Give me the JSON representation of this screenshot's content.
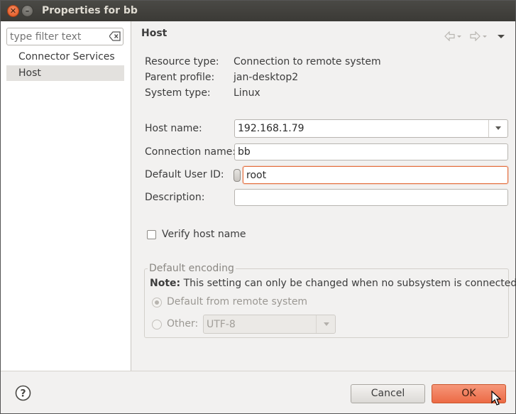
{
  "window": {
    "title": "Properties for bb",
    "close_glyph": "✕",
    "minimize_glyph": "–"
  },
  "sidebar": {
    "filter_placeholder": "type filter text",
    "items": [
      {
        "label": "Connector Services",
        "selected": false
      },
      {
        "label": "Host",
        "selected": true
      }
    ]
  },
  "page": {
    "title": "Host"
  },
  "info": {
    "resource_type_label": "Resource type:",
    "resource_type_value": "Connection to remote system",
    "parent_profile_label": "Parent profile:",
    "parent_profile_value": "jan-desktop2",
    "system_type_label": "System type:",
    "system_type_value": "Linux"
  },
  "form": {
    "host_name_label": "Host name:",
    "host_name_value": "192.168.1.79",
    "connection_name_label": "Connection name:",
    "connection_name_value": "bb",
    "default_user_id_label": "Default User ID:",
    "default_user_id_value": "root",
    "description_label": "Description:",
    "description_value": "",
    "verify_host_label": "Verify host name",
    "verify_host_checked": false
  },
  "encoding": {
    "group_title": "Default encoding",
    "note_bold": "Note:",
    "note_text": " This setting can only be changed when no subsystem is connected",
    "default_option": "Default from remote system",
    "other_option": "Other:",
    "other_value": "UTF-8",
    "selected": "default"
  },
  "buttons": {
    "cancel": "Cancel",
    "ok": "OK",
    "help_icon": "help-icon"
  },
  "colors": {
    "accent": "#ec6a45",
    "focus_border": "#e5703f",
    "titlebar": "#3b3a36"
  }
}
